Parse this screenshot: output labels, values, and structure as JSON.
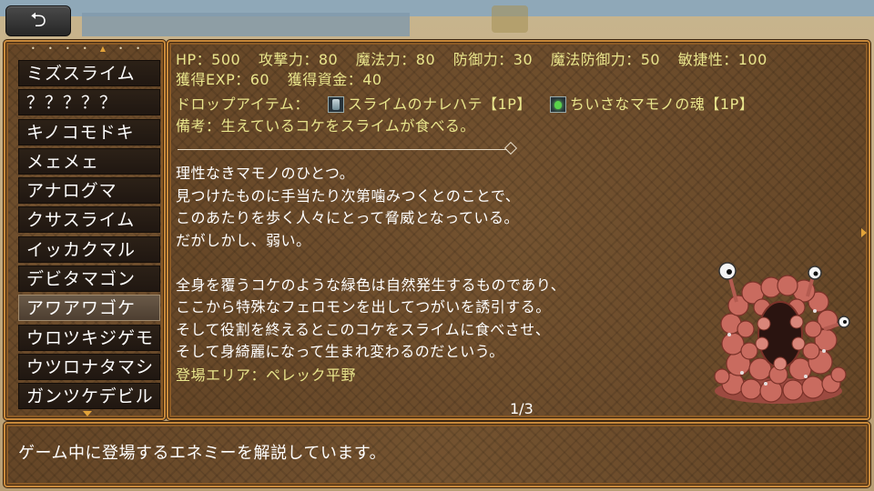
{
  "back_button": {
    "icon": "return-arrow-icon",
    "glyph": "⮌"
  },
  "enemy_list": {
    "items": [
      {
        "label": "ミズスライム",
        "selected": false
      },
      {
        "label": "？？？？？",
        "selected": false
      },
      {
        "label": "キノコモドキ",
        "selected": false
      },
      {
        "label": "メェメェ",
        "selected": false
      },
      {
        "label": "アナログマ",
        "selected": false
      },
      {
        "label": "クサスライム",
        "selected": false
      },
      {
        "label": "イッカクマル",
        "selected": false
      },
      {
        "label": "デビタマゴン",
        "selected": false
      },
      {
        "label": "アワアワゴケ",
        "selected": true
      },
      {
        "label": "ウロツキジゲモ",
        "selected": false
      },
      {
        "label": "ウツロナタマシ",
        "selected": false
      },
      {
        "label": "ガンツケデビル",
        "selected": false
      }
    ]
  },
  "detail": {
    "stats": [
      "HP：500",
      "攻撃力：80",
      "魔法力：80",
      "防御力：30",
      "魔法防御力：50",
      "敏捷性：100"
    ],
    "rewards": [
      "獲得EXP：60",
      "獲得資金：40"
    ],
    "drop_label": "ドロップアイテム：",
    "drops": [
      {
        "icon": "slime-jar-icon",
        "name": "スライムのナレハテ【1P】"
      },
      {
        "icon": "monster-soul-icon",
        "name": "ちいさなマモノの魂【1P】"
      }
    ],
    "note": "備考：生えているコケをスライムが食べる。",
    "description": [
      "理性なきマモノのひとつ。",
      "見つけたものに手当たり次第噛みつくとのことで、",
      "このあたりを歩く人々にとって脅威となっている。",
      "だがしかし、弱い。",
      "",
      "全身を覆うコケのような緑色は自然発生するものであり、",
      "ここから特殊なフェロモンを出してつがいを誘引する。",
      "そして役割を終えるとこのコケをスライムに食べさせ、",
      "そして身綺麗になって生まれ変わるのだという。"
    ],
    "area": "登場エリア：ペレック平野",
    "page": "1/3"
  },
  "help": {
    "text": "ゲーム中に登場するエネミーを解説しています。"
  },
  "colors": {
    "panel_wood": "#6b4a29",
    "panel_border": "#c8893a",
    "highlight_text": "#e9e58c",
    "list_item_bg": "#2c2117",
    "selected_item_bg": "#5b4c3c",
    "monster_body": "#c86a5e"
  }
}
